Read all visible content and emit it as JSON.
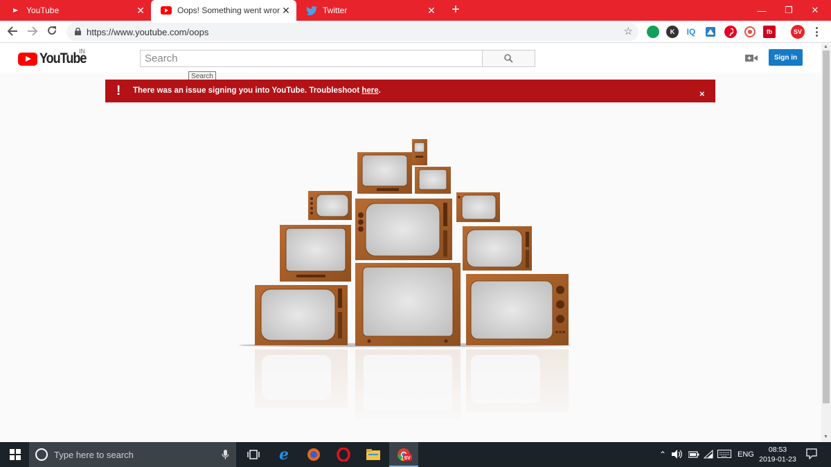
{
  "browser": {
    "tabs": [
      {
        "title": "YouTube",
        "close": "✕"
      },
      {
        "title": "Oops! Something went wrong. -",
        "close": "✕"
      },
      {
        "title": "Twitter",
        "close": "✕"
      }
    ],
    "new_tab": "+",
    "window_controls": {
      "minimize": "—",
      "maximize": "❐",
      "close": "✕"
    },
    "url": "https://www.youtube.com/oops",
    "extensions": [
      {
        "name": "grammarly",
        "label": "",
        "color": "#15a05a"
      },
      {
        "name": "k-ext",
        "label": "K",
        "color": "#333333"
      },
      {
        "name": "iq",
        "label": "IQ",
        "color": "#2e8be0"
      },
      {
        "name": "ext-a",
        "label": "",
        "color": "#2a7fbf"
      },
      {
        "name": "pinterest",
        "label": "",
        "color": "#e60023"
      },
      {
        "name": "target-ext",
        "label": "",
        "color": "#e84c3d"
      },
      {
        "name": "fb-ext",
        "label": "fb",
        "color": "#d0011b"
      },
      {
        "name": "sv-ext",
        "label": "SV",
        "color": "#e8232b"
      }
    ]
  },
  "youtube": {
    "logo_text": "YouTube",
    "region": "IN",
    "search_placeholder": "Search",
    "search_tooltip": "Search",
    "signin_label": "Sign in",
    "alert": {
      "icon": "!",
      "message_prefix": "There was an issue signing you into YouTube. Troubleshoot ",
      "link_text": "here",
      "message_suffix": ".",
      "close": "×"
    }
  },
  "taskbar": {
    "search_placeholder": "Type here to search",
    "language": "ENG",
    "time": "08:53",
    "date": "2019-01-23"
  }
}
